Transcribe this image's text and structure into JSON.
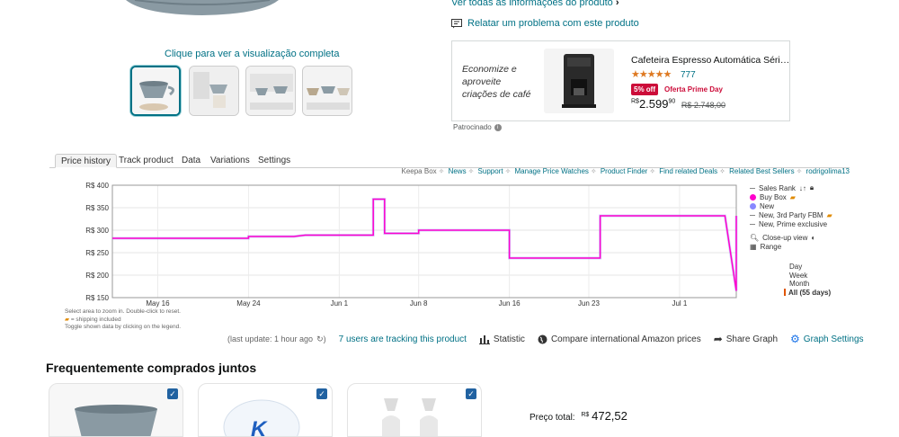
{
  "product": {
    "preview_link": "Clique para ver a visualização completa",
    "see_all_info": "Ver todas as informações do produto",
    "report_problem": "Relatar um problema com este produto",
    "thumbnails": [
      "coffee-dripper-gray",
      "dripper-with-cup",
      "dripper-set-on-table",
      "dripper-group"
    ]
  },
  "ad": {
    "tagline_line1": "Economize e",
    "tagline_line2": "aproveite",
    "tagline_line3": "criações de café",
    "title": "Cafeteira Espresso Automática Séri…",
    "stars": "★★★★★",
    "rating_count": "777",
    "discount_badge": "5% off",
    "deal_label": "Oferta Prime Day",
    "price_currency": "R$",
    "price_whole": "2.599",
    "price_cents": "90",
    "old_price": "R$ 2.748,00",
    "sponsored": "Patrocinado"
  },
  "keepa": {
    "tabs": [
      "Price history",
      "Track product",
      "Data",
      "Variations",
      "Settings"
    ],
    "active_tab": "Price history",
    "links": [
      "Keepa Box",
      "News",
      "Support",
      "Manage Price Watches",
      "Product Finder",
      "Find related Deals",
      "Related Best Sellers",
      "rodrigolima13"
    ],
    "legend": {
      "sales_rank": "Sales Rank",
      "buy_box": "Buy Box",
      "new": "New",
      "new_3p_fbm": "New, 3rd Party FBM",
      "new_prime": "New, Prime exclusive",
      "closeup": "Close-up view",
      "range": "Range",
      "range_options": [
        "Day",
        "Week",
        "Month",
        "All (55 days)"
      ]
    },
    "help_line1": "Select area to zoom in. Double-click to reset.",
    "help_line2": "= shipping included",
    "help_line3": "Toggle shown data by clicking on the legend.",
    "toolbar": {
      "last_update": "(last update: 1 hour ago",
      "tracking": "7 users are tracking this product",
      "statistic": "Statistic",
      "compare": "Compare international Amazon prices",
      "share": "Share Graph",
      "settings": "Graph Settings"
    }
  },
  "colors": {
    "teal_link": "#007185",
    "buy_box": "#ff00cc",
    "new": "#8888ff",
    "deal_red": "#cc0c39",
    "star": "#de7921"
  },
  "chart_data": {
    "type": "line",
    "title": "",
    "ylabel": "",
    "xlabel": "",
    "y_ticks": [
      "R$ 400",
      "R$ 350",
      "R$ 300",
      "R$ 250",
      "R$ 200",
      "R$ 150"
    ],
    "ylim": [
      150,
      400
    ],
    "x_ticks": [
      "May 16",
      "May 24",
      "Jun 1",
      "Jun 8",
      "Jun 16",
      "Jun 23",
      "Jul 1"
    ],
    "series": [
      {
        "name": "New",
        "points": [
          [
            "May 12",
            282
          ],
          [
            "May 24",
            282
          ],
          [
            "May 24",
            286
          ],
          [
            "May 28",
            286
          ],
          [
            "May 29",
            289
          ],
          [
            "Jun 4",
            289
          ],
          [
            "Jun 4",
            369
          ],
          [
            "Jun 5",
            369
          ],
          [
            "Jun 5",
            293
          ],
          [
            "Jun 8",
            293
          ],
          [
            "Jun 8",
            300
          ],
          [
            "Jun 16",
            300
          ],
          [
            "Jun 16",
            238
          ],
          [
            "Jun 24",
            238
          ],
          [
            "Jun 24",
            332
          ],
          [
            "Jul 5",
            332
          ],
          [
            "Jul 6",
            165
          ],
          [
            "Jul 6",
            332
          ]
        ]
      }
    ],
    "grid": true
  },
  "frequent": {
    "title": "Frequentemente comprados juntos",
    "total_label": "Preço total:",
    "total_currency": "R$",
    "total_value": "472,52",
    "items": [
      "gray-dripper",
      "coffee-filters",
      "glass-servers"
    ]
  }
}
